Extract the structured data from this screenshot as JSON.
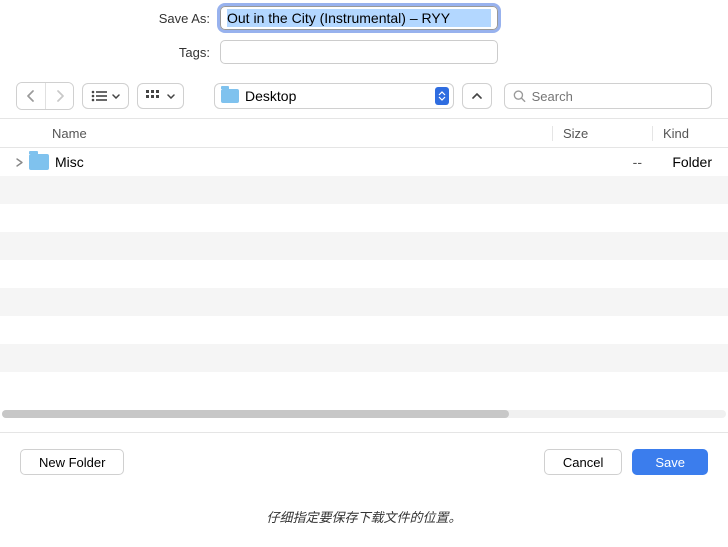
{
  "saveAs": {
    "label": "Save As:",
    "value": "Out in the City (Instrumental) – RYY"
  },
  "tags": {
    "label": "Tags:",
    "value": ""
  },
  "location": {
    "current": "Desktop"
  },
  "search": {
    "placeholder": "Search"
  },
  "columns": {
    "name": "Name",
    "size": "Size",
    "kind": "Kind"
  },
  "files": [
    {
      "name": "Misc",
      "size": "--",
      "kind": "Folder",
      "isFolder": true
    }
  ],
  "buttons": {
    "newFolder": "New Folder",
    "cancel": "Cancel",
    "save": "Save"
  },
  "caption": "仔细指定要保存下载文件的位置。"
}
